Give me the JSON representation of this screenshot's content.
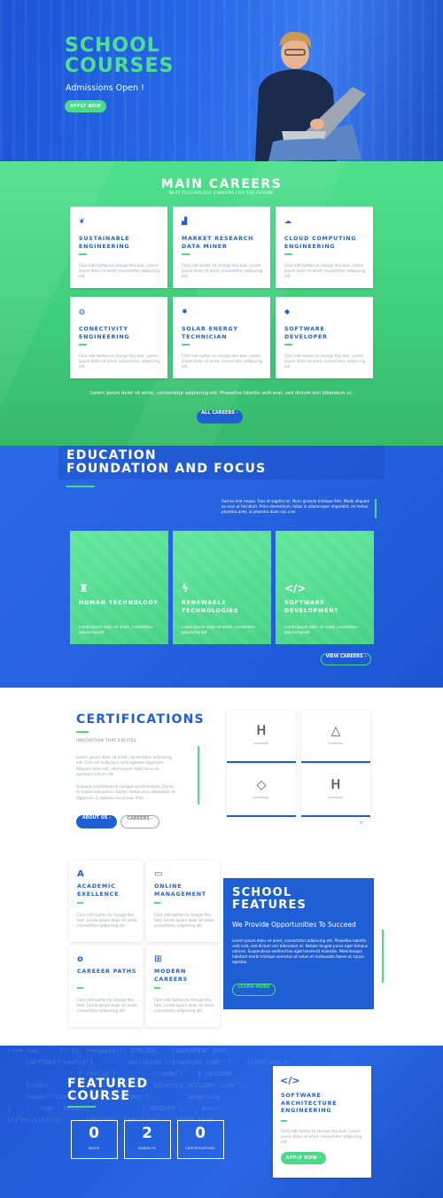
{
  "hero": {
    "title": "SCHOOL COURSES",
    "subtitle": "Admissions Open !",
    "button": "APPLY NOW"
  },
  "careers": {
    "title": "MAIN CAREERS",
    "subtitle": "BEST TECHNOLOGY CAREERS FOR THE FUTURE",
    "cards": [
      {
        "icon": "leaf-icon",
        "glyph": "❦",
        "title": "SUSTAINABLE ENGINEERING",
        "text": "Click edit button to change this text. Lorem ipsum dolor sit amet, consectetur adipiscing elit"
      },
      {
        "icon": "chart-icon",
        "glyph": "▟",
        "title": "MARKET RESEARCH DATA MINER",
        "text": "Click edit button to change this text. Lorem ipsum dolor sit amet, consectetur adipiscing elit"
      },
      {
        "icon": "cloud-icon",
        "glyph": "☁",
        "title": "CLOUD COMPUTING ENGINEERING",
        "text": "Click edit button to change this text. Lorem ipsum dolor sit amet, consectetur adipiscing elit"
      },
      {
        "icon": "globe-icon",
        "glyph": "◍",
        "title": "CONECTIVITY ENGINEERING",
        "text": "Click edit button to change this text. Lorem ipsum dolor sit amet, consectetur adipiscing elit"
      },
      {
        "icon": "gear-icon",
        "glyph": "✹",
        "title": "SOLAR ENERGY TECHNICIAN",
        "text": "Click edit button to change this text. Lorem ipsum dolor sit amet, consectetur adipiscing elit"
      },
      {
        "icon": "cube-icon",
        "glyph": "◆",
        "title": "SOFTWARE DEVELOPER",
        "text": "Click edit button to change this text. Lorem ipsum dolor sit amet, consectetur adipiscing elit"
      }
    ],
    "text": "Lorem ipsum dolor sit amet, consectetur adipiscing elit. Phasellus lobortis velit erat, sed dictum orci bibendum ut.",
    "button": "ALL CAREERS ›"
  },
  "education": {
    "title_line1": "EDUCATION",
    "title_line2": "FOUNDATION AND FOCUS",
    "text": "Sed eu erat neque. Duis et sagittis mi. Nunc gravida tristique felis. Morbi aliquam eu eros ut tincidunt. Proin elementum, tellus in ullamcorper imperdiet, mi metus pharetra ante, id pharetra diam nisi a mi",
    "cards": [
      {
        "icon": "person-icon",
        "glyph": "♜",
        "title": "HUMAN TECHNOLOGY",
        "text": "Lorem ipsum dolor sit amet, consectetur adipiscing elit"
      },
      {
        "icon": "bolt-icon",
        "glyph": "ϟ",
        "title": "RENEWABLE TECHNOLOGIES",
        "text": "Lorem ipsum dolor sit amet, consectetur adipiscing elit"
      },
      {
        "icon": "code-icon",
        "glyph": "</>",
        "title": "SOFTWARE DEVELOPMENT",
        "text": "Lorem ipsum dolor sit amet, consectetur adipiscing elit"
      }
    ],
    "button": "VIEW CAREERS ›"
  },
  "certifications": {
    "title": "CERTIFICATIONS",
    "subtitle": "INNOVATION THAT EXCITES",
    "p1": "Lorem ipsum dolor sit amet, consectetur adipiscing elit. Cras vel nulla quis nulla egestas dignissim. Aliquam ante nisl, ullamcorper eget lacus et, euismod rutrum nisi.",
    "p2": "Quisque condimentum congue condimentum. Donec et malesuada purus. Donec metus arcu, bibendum et dignissim a, egestas accumsan felis.",
    "about_button": "ABOUT US ›",
    "careers_button": "CAREERS ›",
    "logos": [
      {
        "mark": "Ꮋ",
        "caption": "COMPANY"
      },
      {
        "mark": "△",
        "caption": "COMPANY"
      },
      {
        "mark": "◇",
        "caption": "COMPANY"
      },
      {
        "mark": "Ꮋ",
        "caption": "COMPANY"
      }
    ]
  },
  "features": {
    "cards": [
      {
        "icon": "letter-a-icon",
        "glyph": "A",
        "title": "ACADEMIC EXELLENCE",
        "text": "Click edit button to change this text. Lorem ipsum dolor sit amet, consectetur adipiscing elit"
      },
      {
        "icon": "folder-icon",
        "glyph": "▭",
        "title": "ONLINE MANAGEMENT",
        "text": "Click edit button to change this text. Lorem ipsum dolor sit amet, consectetur adipiscing elit"
      },
      {
        "icon": "circle-icon",
        "glyph": "o",
        "title": "CAREEER PATHS",
        "text": "Click edit button to change this text. Lorem ipsum dolor sit amet, consectetur adipiscing elit"
      },
      {
        "icon": "gamepad-icon",
        "glyph": "⊞",
        "title": "MODERN CAREERS",
        "text": "Click edit button to change this text. Lorem ipsum dolor sit amet, consectetur adipiscing elit"
      }
    ],
    "box_title_line1": "SCHOOL",
    "box_title_line2": "FEATURES",
    "box_subtitle": "We Provide Opportunities To Succeed",
    "box_text": "Lorem ipsum dolor sit amet, consectetur adipiscing elit. Phasellus lobortis velit erat, sed dictum orci bibendum ut. Nullam feugiat purus eget tempus ultrices. Suspendisse eleifend leo eget hendrerit molestie. Pellentesque habitant morbi tristique senectus et netus et malesuada fames ac turpis egestas.",
    "box_button": "LEARN MORE"
  },
  "featured": {
    "title_line1": "FEATURED",
    "title_line2": "COURSE",
    "stats": [
      {
        "value": "0",
        "label": "SEATS"
      },
      {
        "value": "2",
        "label": "SUBJECTS"
      },
      {
        "value": "0",
        "label": "CERTIFICATIONS"
      }
    ],
    "card": {
      "icon": "code-icon",
      "glyph": "</>",
      "title": "SOFTWARE ARCHITECTURE ENGINEERING",
      "text": "Click edit button to change this text. Lorem ipsum dolor sit amet, consectetur adipiscing elit",
      "button": "APPLY NOW ›"
    }
  },
  "colors": {
    "brand_blue": "#1f5fd6",
    "brand_green": "#4cd988"
  }
}
